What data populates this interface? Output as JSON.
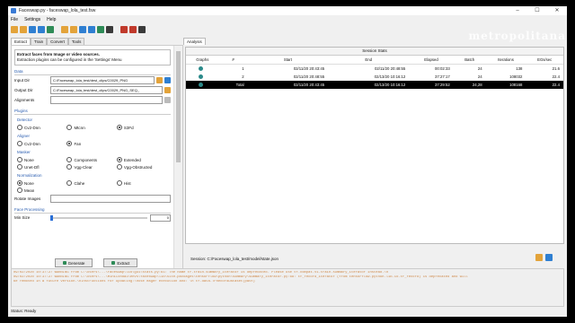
{
  "window": {
    "title": "Faceswap.py - faceswap_lola_test.fsw",
    "min": "–",
    "max": "☐",
    "close": "✕"
  },
  "menu": [
    "File",
    "Settings",
    "Help"
  ],
  "toolbar": {
    "icons": [
      {
        "name": "new-icon",
        "color": "#e3a33a"
      },
      {
        "name": "open-icon",
        "color": "#e3a33a"
      },
      {
        "name": "save-icon",
        "color": "#2f7fd1"
      },
      {
        "name": "save-as-icon",
        "color": "#2f7fd1"
      },
      {
        "name": "reload-icon",
        "color": "#2e8b57"
      },
      {
        "name": "sep",
        "color": ""
      },
      {
        "name": "new-task-icon",
        "color": "#e3a33a"
      },
      {
        "name": "open-task-icon",
        "color": "#e3a33a"
      },
      {
        "name": "save-task-icon",
        "color": "#2f7fd1"
      },
      {
        "name": "save-task-as-icon",
        "color": "#2f7fd1"
      },
      {
        "name": "reset-icon",
        "color": "#2e8b57"
      },
      {
        "name": "clear-icon",
        "color": "#3a3a3a"
      },
      {
        "name": "sep",
        "color": ""
      },
      {
        "name": "project-new-icon",
        "color": "#c0392b"
      },
      {
        "name": "project-open-icon",
        "color": "#c0392b"
      },
      {
        "name": "project-save-icon",
        "color": "#3a3a3a"
      }
    ]
  },
  "watermark": "metropolitana",
  "tabs": [
    "Extract",
    "Train",
    "Convert",
    "Tools"
  ],
  "active_tab": 0,
  "info": {
    "line1": "Extract faces from Image or video sources.",
    "line2": "Extraction plugins can be configured in the 'Settings' Menu"
  },
  "data_section": {
    "title": "Data",
    "input_dir": {
      "label": "Input Dir",
      "value": "C:/Faceswap_lola_test/dest_clips/C0029_PNG"
    },
    "output_dir": {
      "label": "Output Dir",
      "value": "C:/Faceswap_lola_test/dest_clips/C0029_PNG_SEQ_"
    },
    "alignments": {
      "label": "Alignments",
      "value": ""
    }
  },
  "plugins": {
    "title": "Plugins",
    "detector": {
      "title": "Detector",
      "options": [
        "Cv2-Dnn",
        "Mtcnn",
        "S3Fd"
      ],
      "selected": 2
    },
    "aligner": {
      "title": "Aligner",
      "options": [
        "Cv2-Dnn",
        "Fan"
      ],
      "selected": 1
    },
    "masker": {
      "title": "Masker",
      "options": [
        "None",
        "Components",
        "Extended",
        "Unet-Dfl",
        "Vgg-Clear",
        "Vgg-Obstructed"
      ],
      "selected": 2
    },
    "normalization": {
      "title": "Normalization",
      "options": [
        "None",
        "Clahe",
        "Hist",
        "Mean"
      ],
      "selected": 0
    },
    "rotate_images": {
      "label": "Rotate Images",
      "value": ""
    }
  },
  "face_processing": {
    "title": "Face Processing",
    "min_size": {
      "label": "Min Size",
      "value": "0",
      "level": 0
    }
  },
  "buttons": {
    "generate": "Generate",
    "extract": "Extract"
  },
  "analysis": {
    "tab": "Analysis",
    "header": "Session Stats",
    "columns": [
      "Graphs",
      "#",
      "Start",
      "End",
      "Elapsed",
      "Batch",
      "Iterations",
      "EGs/sec"
    ],
    "rows": [
      {
        "id": "1",
        "start": "02/11/20 20:43:45",
        "end": "02/11/20 20:48:55",
        "elapsed": "00:02:33",
        "batch": "24",
        "iterations": "138",
        "egs": "21.6"
      },
      {
        "id": "2",
        "start": "02/11/20 20:48:55",
        "end": "02/13/20 10:16:12",
        "elapsed": "37:27:17",
        "batch": "24",
        "iterations": "108032",
        "egs": "22.4"
      }
    ],
    "total": {
      "id": "Total",
      "start": "02/11/20 20:43:45",
      "end": "02/13/20 10:16:12",
      "elapsed": "37:29:52",
      "batch": "24,28",
      "iterations": "108168",
      "egs": "22.4"
    },
    "session_label": "Session: C:/Faceswap_lola_test/model/state.json"
  },
  "console": [
    "09/02/2020 10:37:27 WARNING  From C:\\Users\\...\\faceswap\\lib\\gui\\stats.py:61: The name tf.train.summary_iterator is deprecated. Please use tf.compat.v1.train.summary_iterator instead.\\n",
    "09/02/2020 10:37:27 WARNING  From C:\\Users\\...\\MiniConda3\\envs\\faceswap\\lib\\site-packages\\tensorflow\\python\\summary\\summary_iterator.py:68: tf_record_iterator (from tensorflow.python.lib.io.tf_record) is deprecated and will",
    "be removed in a future version.\\nInstructions for updating:\\nUse eager execution and: \\n tf.data.TFRecordDataset(path)"
  ],
  "status": "Status: Ready"
}
